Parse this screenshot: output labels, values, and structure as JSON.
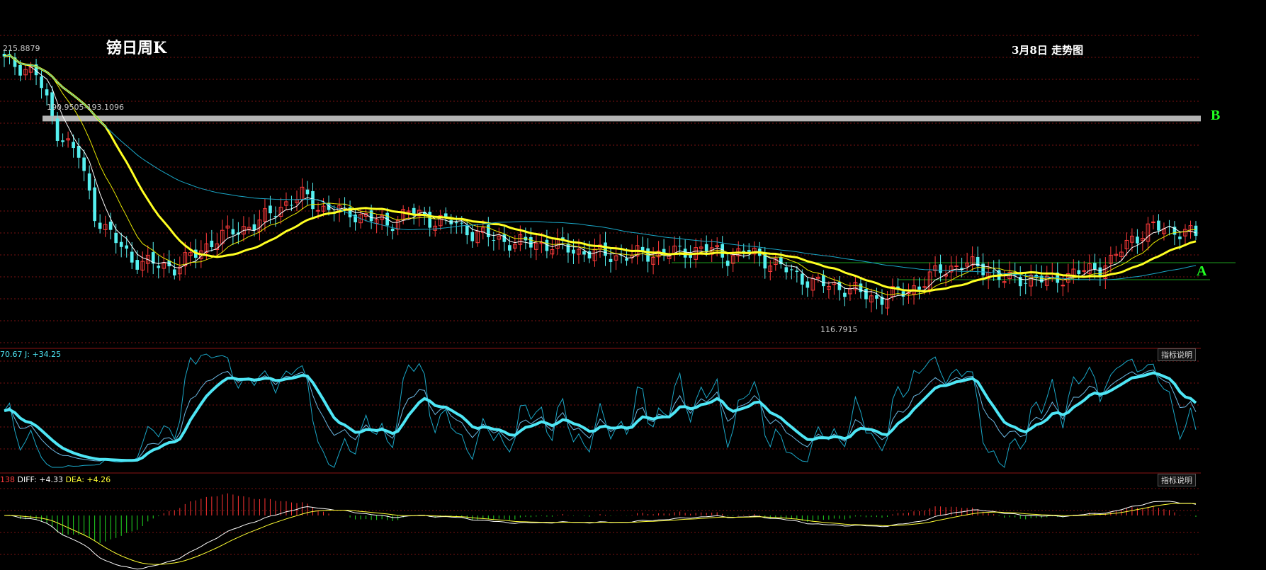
{
  "title": "镑日周K",
  "date_label": "3月8日 走势图",
  "levels": {
    "b_label": "B",
    "a_label": "A",
    "high_tag": "215.8879",
    "low_tag": "116.7915",
    "band_tag": "190.9505-193.1096"
  },
  "indicators": {
    "kdj_header": {
      "k": "70.67",
      "j_prefix": "J:",
      "j": "+34.25"
    },
    "macd_header": {
      "macd": "138",
      "diff_prefix": "DIFF:",
      "diff": "+4.33",
      "dea_prefix": "DEA:",
      "dea": "+4.26"
    },
    "explain_label": "指标说明"
  },
  "colors": {
    "up": "#ff3b3b",
    "down": "#55f0f0",
    "ma_thick": "#ffff22",
    "ma_thin": "#ffffff",
    "ma_yellow_thin": "#e6e600",
    "ma_cyan": "#1aa7c7",
    "band": "#b4b4b4",
    "kdj": "#4ee6f5",
    "diff": "#ffffff",
    "dea": "#ffff33",
    "hist_up": "#ff3333",
    "hist_down": "#22dd22",
    "grid": "#7a1212",
    "support": "#1e9e1e"
  },
  "chart_data": {
    "type": "candlestick",
    "price_series_anchors": [
      [
        0,
        214
      ],
      [
        6,
        209
      ],
      [
        10,
        187
      ],
      [
        14,
        178
      ],
      [
        17,
        156
      ],
      [
        20,
        148
      ],
      [
        24,
        139
      ],
      [
        28,
        137
      ],
      [
        32,
        136
      ],
      [
        36,
        141
      ],
      [
        40,
        147
      ],
      [
        44,
        150
      ],
      [
        48,
        153
      ],
      [
        52,
        159
      ],
      [
        56,
        163
      ],
      [
        60,
        158
      ],
      [
        64,
        157
      ],
      [
        68,
        155
      ],
      [
        72,
        152
      ],
      [
        76,
        157
      ],
      [
        80,
        154
      ],
      [
        84,
        153
      ],
      [
        88,
        149
      ],
      [
        92,
        147
      ],
      [
        96,
        145
      ],
      [
        100,
        145
      ],
      [
        104,
        144
      ],
      [
        108,
        142
      ],
      [
        112,
        141
      ],
      [
        116,
        140
      ],
      [
        120,
        141
      ],
      [
        124,
        141
      ],
      [
        128,
        142
      ],
      [
        132,
        143
      ],
      [
        136,
        140
      ],
      [
        140,
        142
      ],
      [
        144,
        138
      ],
      [
        148,
        134
      ],
      [
        152,
        130
      ],
      [
        156,
        129
      ],
      [
        160,
        127
      ],
      [
        164,
        124
      ],
      [
        168,
        126
      ],
      [
        172,
        129
      ],
      [
        176,
        135
      ],
      [
        180,
        137
      ],
      [
        184,
        136
      ],
      [
        188,
        131
      ],
      [
        192,
        132
      ],
      [
        196,
        131
      ],
      [
        200,
        133
      ],
      [
        204,
        135
      ],
      [
        208,
        138
      ],
      [
        212,
        147
      ],
      [
        216,
        151
      ],
      [
        220,
        150
      ],
      [
        224,
        148
      ]
    ],
    "high_value": 215.8879,
    "low_value": 116.7915,
    "band_range": [
      190.9505,
      193.1096
    ],
    "ylim": [
      106,
      222
    ]
  }
}
